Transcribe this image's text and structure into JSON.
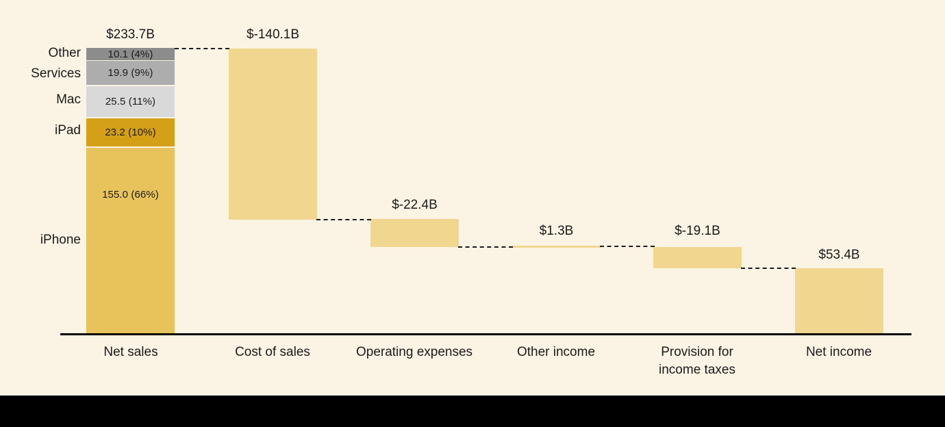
{
  "chart_data": {
    "type": "bar",
    "subtype": "waterfall",
    "title": "",
    "xlabel": "",
    "ylabel": "",
    "units": "USD Billions",
    "categories": [
      "Net sales",
      "Cost of sales",
      "Operating expenses",
      "Other income",
      "Provision for income taxes",
      "Net income"
    ],
    "values": [
      233.7,
      -140.1,
      -22.4,
      1.3,
      -19.1,
      53.4
    ],
    "value_labels": [
      "$233.7B",
      "$-140.1B",
      "$-22.4B",
      "$1.3B",
      "$-19.1B",
      "$53.4B"
    ],
    "cumulative_start": [
      0,
      233.7,
      93.6,
      71.2,
      72.5,
      0
    ],
    "cumulative_end": [
      233.7,
      93.6,
      71.2,
      72.5,
      53.4,
      53.4
    ],
    "is_total": [
      true,
      false,
      false,
      false,
      false,
      true
    ],
    "breakdown": {
      "parent": "Net sales",
      "segments": [
        {
          "name": "Other",
          "value": 10.1,
          "percent": "4%",
          "label": "10.1 (4%)",
          "color": "#8C8C8C"
        },
        {
          "name": "Services",
          "value": 19.9,
          "percent": "9%",
          "label": "19.9 (9%)",
          "color": "#ADADAD"
        },
        {
          "name": "Mac",
          "value": 25.5,
          "percent": "11%",
          "label": "25.5 (11%)",
          "color": "#D9D9D9"
        },
        {
          "name": "iPad",
          "value": 23.2,
          "percent": "10%",
          "label": "23.2 (10%)",
          "color": "#D4A017"
        },
        {
          "name": "iPhone",
          "value": 155.0,
          "percent": "66%",
          "label": "155.0 (66%)",
          "color": "#E8C35C"
        }
      ]
    },
    "colors": {
      "background": "#FBF3E4",
      "bar_fill": "#F0D68F",
      "total_fill": "#F0D68F",
      "axis": "#000000",
      "connector": "#1a1a1a",
      "footer": "#000000"
    },
    "grid": false,
    "legend": "none",
    "axis_range": [
      0,
      233.7
    ]
  },
  "axis": {
    "tick_labels": [
      {
        "line1": "Net sales",
        "line2": ""
      },
      {
        "line1": "Cost of sales",
        "line2": ""
      },
      {
        "line1": "Operating expenses",
        "line2": ""
      },
      {
        "line1": "Other income",
        "line2": ""
      },
      {
        "line1": "Provision for",
        "line2": "income taxes"
      },
      {
        "line1": "Net income",
        "line2": ""
      }
    ]
  }
}
